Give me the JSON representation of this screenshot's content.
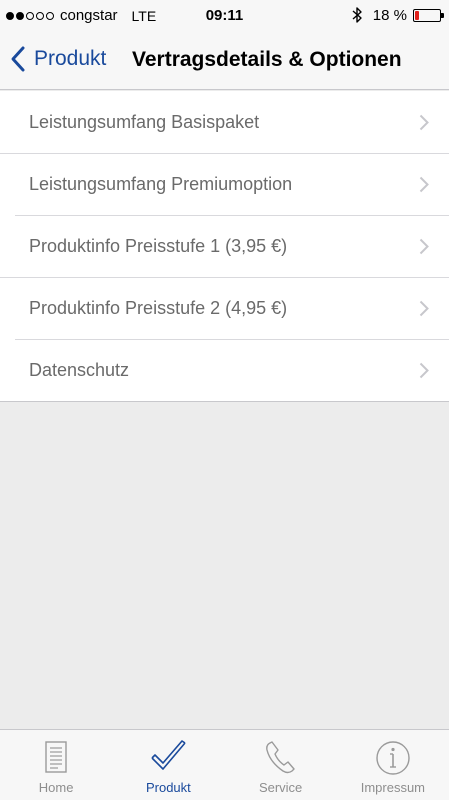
{
  "status_bar": {
    "carrier": "congstar",
    "network": "LTE",
    "time": "09:11",
    "battery_text": "18 %",
    "battery_level": 0.18,
    "signal_bars_filled": 2,
    "signal_bars_total": 5
  },
  "nav": {
    "back_label": "Produkt",
    "title": "Vertragsdetails & Optionen"
  },
  "list": {
    "items": [
      {
        "label": "Leistungsumfang Basispaket"
      },
      {
        "label": "Leistungsumfang Premiumoption"
      },
      {
        "label": "Produktinfo Preisstufe 1 (3,95 €)"
      },
      {
        "label": "Produktinfo Preisstufe 2 (4,95 €)"
      },
      {
        "label": "Datenschutz"
      }
    ]
  },
  "tabs": {
    "items": [
      {
        "label": "Home",
        "icon": "document-icon"
      },
      {
        "label": "Produkt",
        "icon": "checkmark-icon",
        "active": true
      },
      {
        "label": "Service",
        "icon": "phone-icon"
      },
      {
        "label": "Impressum",
        "icon": "info-icon"
      }
    ]
  },
  "colors": {
    "accent": "#1a4a9c",
    "battery_low": "#e0201b",
    "background": "#ececec"
  }
}
